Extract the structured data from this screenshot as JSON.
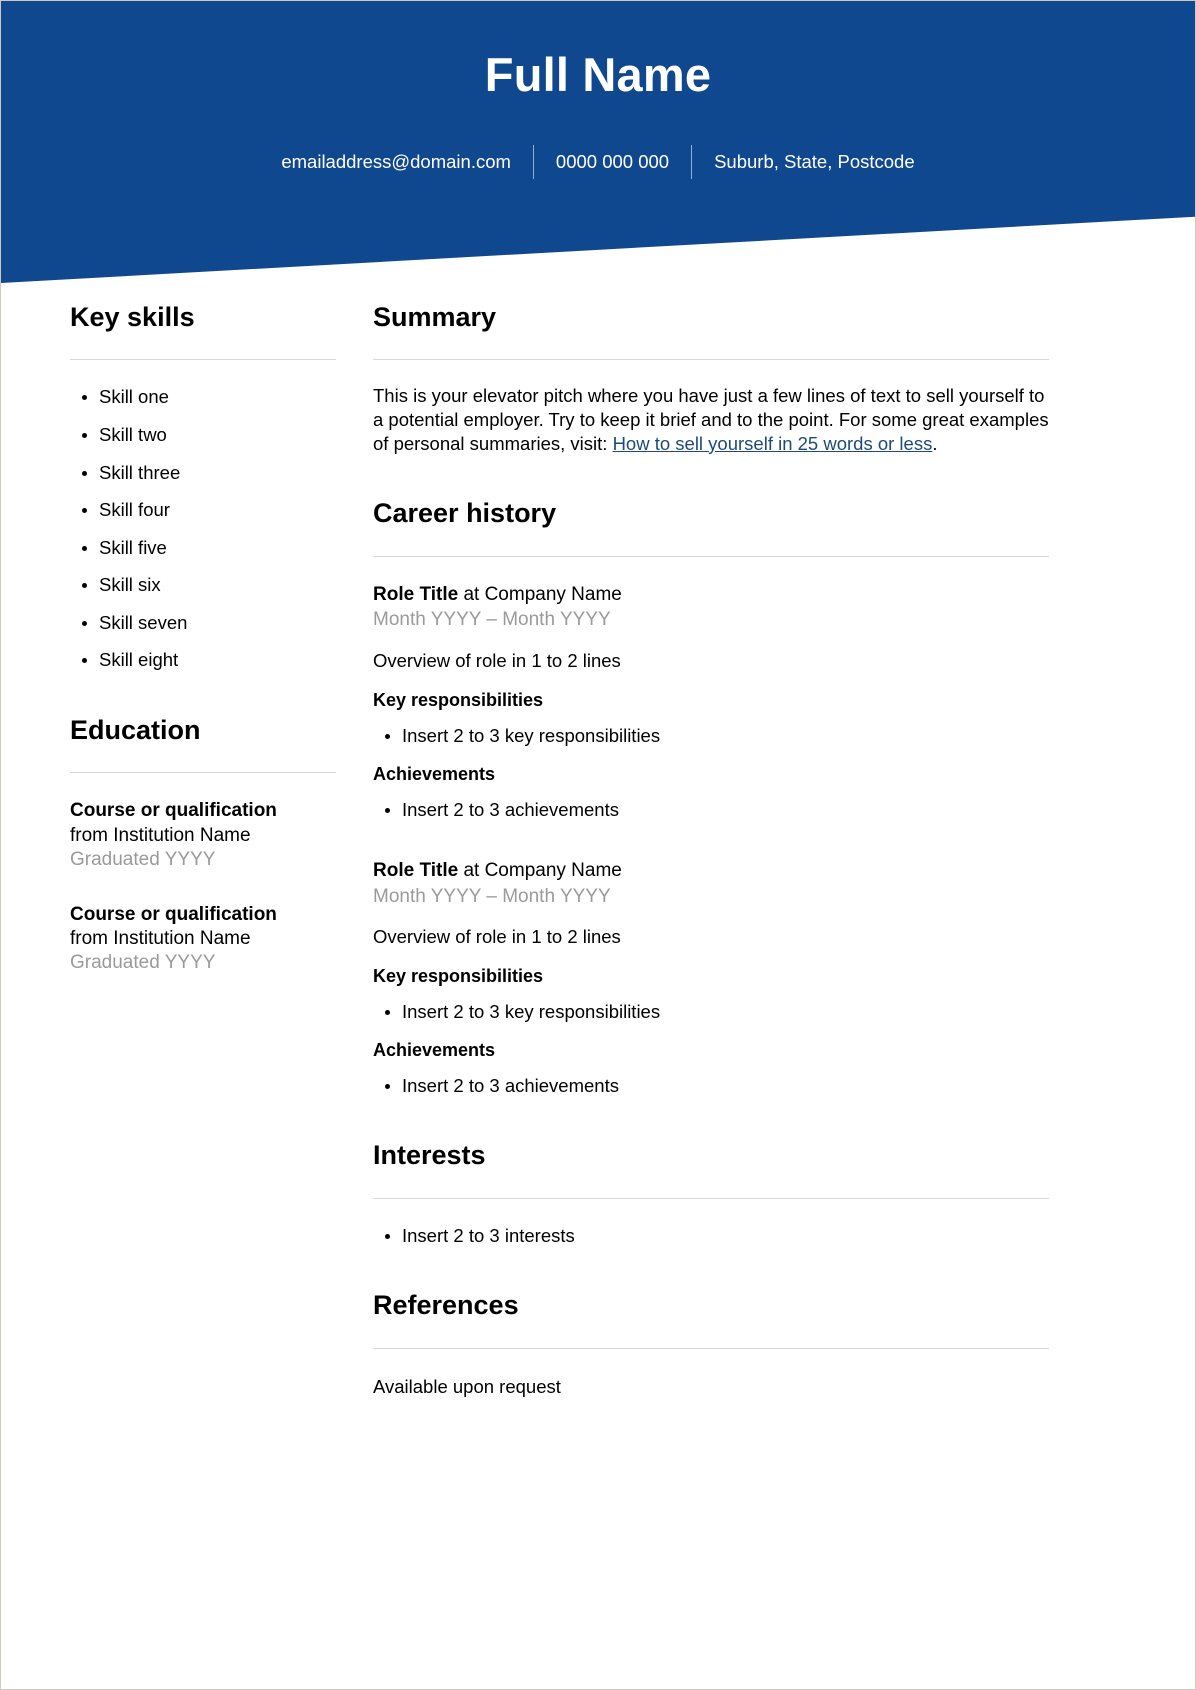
{
  "colors": {
    "banner_blue": "#10488f",
    "link_blue": "#1e4a7a",
    "muted_gray": "#9a9a9a",
    "rule_gray": "#d8d8d8"
  },
  "header": {
    "name": "Full Name",
    "contacts": [
      "emailaddress@domain.com",
      "0000 000 000",
      "Suburb, State, Postcode"
    ]
  },
  "key_skills": {
    "heading": "Key skills",
    "items": [
      "Skill one",
      "Skill two",
      "Skill three",
      "Skill four",
      "Skill five",
      "Skill six",
      "Skill seven",
      "Skill eight"
    ]
  },
  "education": {
    "heading": "Education",
    "entries": [
      {
        "course": "Course or qualification",
        "institution": "from Institution Name",
        "graduated": "Graduated YYYY"
      },
      {
        "course": "Course or qualification",
        "institution": "from Institution Name",
        "graduated": "Graduated YYYY"
      }
    ]
  },
  "summary": {
    "heading": "Summary",
    "text_before_link": "This is your elevator pitch where you have just a few lines of text to sell yourself to a potential employer. Try to keep it brief and to the point. For some great examples of personal summaries, visit: ",
    "link_text": "How to sell yourself in 25 words or less",
    "text_after_link": "."
  },
  "career_history": {
    "heading": "Career history",
    "roles": [
      {
        "title": "Role Title",
        "at": " at ",
        "company": "Company Name",
        "dates": "Month YYYY – Month YYYY",
        "overview": "Overview of role in 1 to 2 lines",
        "responsibilities_heading": "Key responsibilities",
        "responsibilities": [
          "Insert 2 to 3 key responsibilities"
        ],
        "achievements_heading": "Achievements",
        "achievements": [
          "Insert 2 to 3 achievements"
        ]
      },
      {
        "title": "Role Title",
        "at": " at ",
        "company": "Company Name",
        "dates": "Month YYYY – Month YYYY",
        "overview": "Overview of role in 1 to 2 lines",
        "responsibilities_heading": "Key responsibilities",
        "responsibilities": [
          "Insert 2 to 3 key responsibilities"
        ],
        "achievements_heading": "Achievements",
        "achievements": [
          "Insert 2 to 3 achievements"
        ]
      }
    ]
  },
  "interests": {
    "heading": "Interests",
    "items": [
      "Insert 2 to 3 interests"
    ]
  },
  "references": {
    "heading": "References",
    "text": "Available upon request"
  }
}
